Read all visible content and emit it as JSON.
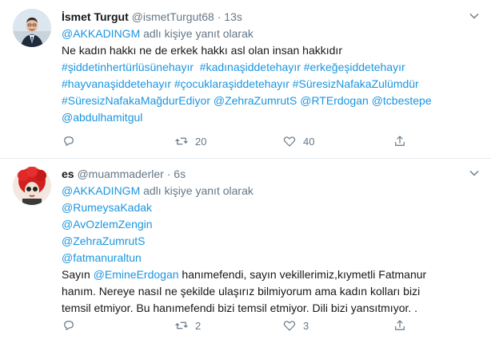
{
  "tweets": [
    {
      "name": "İsmet Turgut",
      "handle": "@ismetTurgut68",
      "dot": "·",
      "time": "13s",
      "reply_target": "@AKKADINGM",
      "reply_suffix": " adlı kişiye yanıt olarak",
      "body_text": "Ne kadın hakkı ne de erkek hakkı asl olan insan hakkıdır",
      "line2": [
        "#şiddetinhertürlüsünehayır",
        "  ",
        "#kadınaşiddetehayır",
        " ",
        "#erkeğeşiddetehayır"
      ],
      "line3": [
        "#hayvanaşiddetehayır",
        " ",
        "#çocuklaraşiddetehayır",
        " ",
        "#SüresizNafakaZulümdür"
      ],
      "line4": [
        "#SüresizNafakaMağdurEdiyor",
        " ",
        "@ZehraZumrutS",
        " ",
        "@RTErdogan",
        " ",
        "@tcbestepe"
      ],
      "line5": "@abdulhamitgul",
      "reply_count": "",
      "retweet_count": "20",
      "like_count": "40"
    },
    {
      "name": "es",
      "handle": "@muammaderler",
      "dot": "·",
      "time": "6s",
      "reply_target": "@AKKADINGM",
      "reply_suffix": " adlı kişiye yanıt olarak",
      "mentions": [
        "@RumeysaKadak",
        "@AvOzlemZengin",
        "@ZehraZumrutS",
        "@fatmanuraltun"
      ],
      "sayin": "Sayın ",
      "mention_inline": "@EmineErdogan",
      "text_a": " hanımefendi, sayın vekillerimiz,kıymetli Fatmanur",
      "text_b": "hanım. Nereye nasıl ne şekilde ulaşırız bilmiyorum ama kadın kolları bizi",
      "text_c": "temsil etmiyor. Bu hanımefendi bizi temsil etmiyor. Dili bizi yansıtmıyor. .",
      "reply_count": "",
      "retweet_count": "2",
      "like_count": "3"
    }
  ],
  "icons": [
    "reply-icon",
    "retweet-icon",
    "like-icon",
    "share-icon",
    "chevron-down-icon"
  ],
  "colors": {
    "link": "#1b95e0",
    "secondary": "#657786",
    "text": "#14171a",
    "divider": "#e6ecf0"
  }
}
